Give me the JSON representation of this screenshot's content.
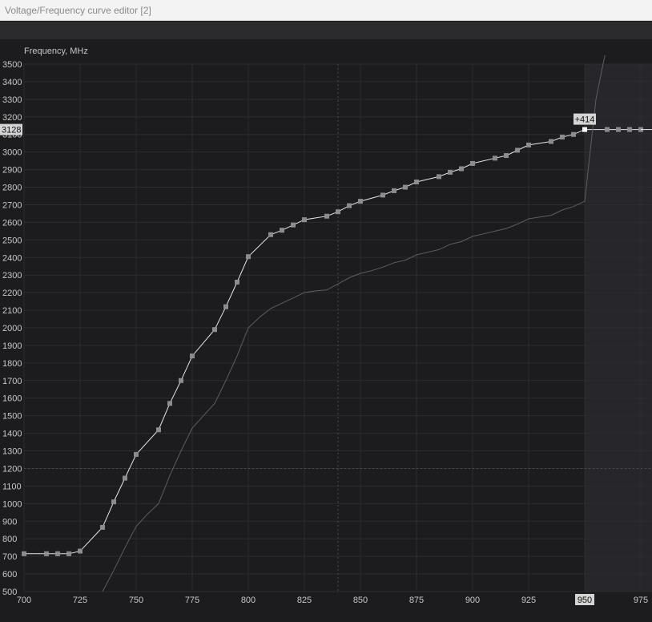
{
  "window": {
    "title": "Voltage/Frequency curve editor [2]"
  },
  "chart_data": {
    "type": "line",
    "ylabel": "Frequency, MHz",
    "xlim": [
      700,
      980
    ],
    "ylim": [
      500,
      3500
    ],
    "x_ticks": [
      700,
      725,
      750,
      775,
      800,
      825,
      850,
      875,
      900,
      925,
      950,
      975
    ],
    "y_ticks": [
      500,
      600,
      700,
      800,
      900,
      1000,
      1100,
      1200,
      1300,
      1400,
      1500,
      1600,
      1700,
      1800,
      1900,
      2000,
      2100,
      2200,
      2300,
      2400,
      2500,
      2600,
      2700,
      2800,
      2900,
      3000,
      3100,
      3200,
      3300,
      3400,
      3500
    ],
    "grid": true,
    "selected_point": {
      "x": 950,
      "y": 3128,
      "x_label": "950",
      "y_label": "3128",
      "offset_label": "+414"
    },
    "crosshair": {
      "x": 840,
      "y": 1200
    },
    "locked_region_start_x": 950,
    "colors": {
      "background": "#1c1c1f",
      "grid": "#2c2c30",
      "axis_text": "#c8c8c8",
      "curve": "#e6e6e6",
      "point": "#8c8c8c",
      "base_curve": "#5e5e62",
      "highlight": "#d4d4d4",
      "locked_region": "#26262b"
    },
    "series": [
      {
        "role": "edited",
        "x": [
          700,
          710,
          715,
          720,
          725,
          735,
          740,
          745,
          750,
          760,
          765,
          770,
          775,
          785,
          790,
          795,
          800,
          810,
          815,
          820,
          825,
          835,
          840,
          845,
          850,
          860,
          865,
          870,
          875,
          885,
          890,
          895,
          900,
          910,
          915,
          920,
          925,
          935,
          940,
          945,
          950,
          960,
          965,
          970,
          975
        ],
        "y": [
          715,
          715,
          715,
          715,
          730,
          865,
          1010,
          1145,
          1280,
          1420,
          1570,
          1700,
          1840,
          1990,
          2120,
          2260,
          2405,
          2530,
          2555,
          2585,
          2615,
          2635,
          2660,
          2695,
          2720,
          2755,
          2780,
          2800,
          2830,
          2860,
          2885,
          2905,
          2935,
          2965,
          2980,
          3010,
          3040,
          3060,
          3085,
          3100,
          3128,
          3128,
          3128,
          3128,
          3128
        ]
      },
      {
        "role": "original",
        "x": [
          735,
          740,
          745,
          750,
          755,
          760,
          765,
          770,
          775,
          780,
          785,
          790,
          795,
          800,
          805,
          810,
          815,
          820,
          825,
          830,
          835,
          840,
          845,
          850,
          855,
          860,
          865,
          870,
          875,
          880,
          885,
          890,
          895,
          900,
          905,
          910,
          915,
          920,
          925,
          930,
          935,
          940,
          945,
          950,
          955,
          959
        ],
        "y": [
          500,
          620,
          750,
          870,
          940,
          1000,
          1160,
          1300,
          1430,
          1500,
          1570,
          1700,
          1840,
          2000,
          2060,
          2110,
          2140,
          2170,
          2200,
          2210,
          2215,
          2250,
          2285,
          2310,
          2325,
          2345,
          2370,
          2385,
          2415,
          2430,
          2445,
          2475,
          2490,
          2520,
          2535,
          2550,
          2565,
          2590,
          2620,
          2630,
          2640,
          2670,
          2690,
          2720,
          3300,
          3550
        ]
      }
    ]
  }
}
